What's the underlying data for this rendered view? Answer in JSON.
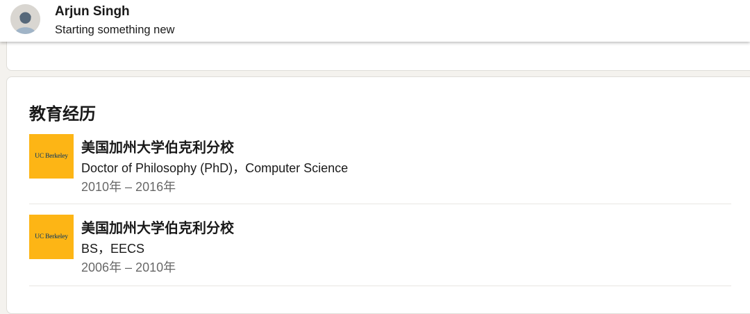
{
  "header": {
    "name": "Arjun Singh",
    "headline": "Starting something new"
  },
  "education": {
    "title": "教育经历",
    "items": [
      {
        "logo_text": "UC Berkeley",
        "school": "美国加州大学伯克利分校",
        "degree": "Doctor of Philosophy (PhD)，Computer Science",
        "dates": "2010年 – 2016年"
      },
      {
        "logo_text": "UC Berkeley",
        "school": "美国加州大学伯克利分校",
        "degree": "BS，EECS",
        "dates": "2006年 – 2010年"
      }
    ]
  },
  "colors": {
    "logo_bg": "#fdb515",
    "logo_text": "#003262",
    "page_bg": "#f4f2ee"
  }
}
